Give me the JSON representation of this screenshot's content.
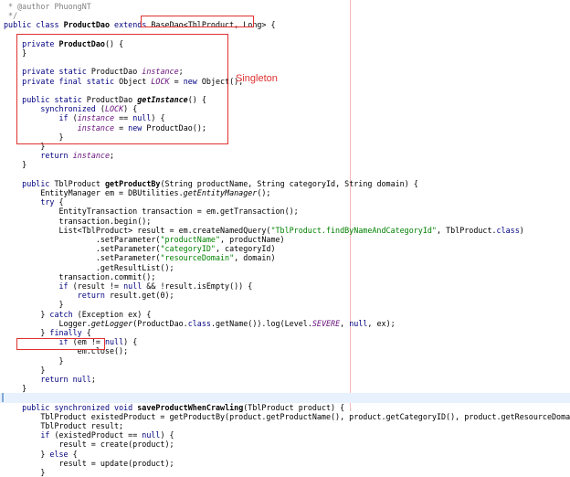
{
  "annotation": "Singleton",
  "code": {
    "lines": [
      " * @author PhuongNT",
      " */",
      "public class ProductDao extends BaseDao<TblProduct, Long> {",
      "",
      "    private ProductDao() {",
      "    }",
      "",
      "    private static ProductDao instance;",
      "    private final static Object LOCK = new Object();",
      "",
      "    public static ProductDao getInstance() {",
      "        synchronized (LOCK) {",
      "            if (instance == null) {",
      "                instance = new ProductDao();",
      "            }",
      "        }",
      "        return instance;",
      "    }",
      "",
      "    public TblProduct getProductBy(String productName, String categoryId, String domain) {",
      "        EntityManager em = DBUtilities.getEntityManager();",
      "        try {",
      "            EntityTransaction transaction = em.getTransaction();",
      "            transaction.begin();",
      "            List<TblProduct> result = em.createNamedQuery(\"TblProduct.findByNameAndCategoryId\", TblProduct.class)",
      "                    .setParameter(\"productName\", productName)",
      "                    .setParameter(\"categoryID\", categoryId)",
      "                    .setParameter(\"resourceDomain\", domain)",
      "                    .getResultList();",
      "            transaction.commit();",
      "            if (result != null && !result.isEmpty()) {",
      "                return result.get(0);",
      "            }",
      "        } catch (Exception ex) {",
      "            Logger.getLogger(ProductDao.class.getName()).log(Level.SEVERE, null, ex);",
      "        } finally {",
      "            if (em != null) {",
      "                em.close();",
      "            }",
      "        }",
      "        return null;",
      "    }",
      "",
      "    public synchronized void saveProductWhenCrawling(TblProduct product) {",
      "        TblProduct existedProduct = getProductBy(product.getProductName(), product.getCategoryID(), product.getResourceDomain());",
      "        TblProduct result;",
      "        if (existedProduct == null) {",
      "            result = create(product);",
      "        } else {",
      "            result = update(product);",
      "        }"
    ]
  }
}
